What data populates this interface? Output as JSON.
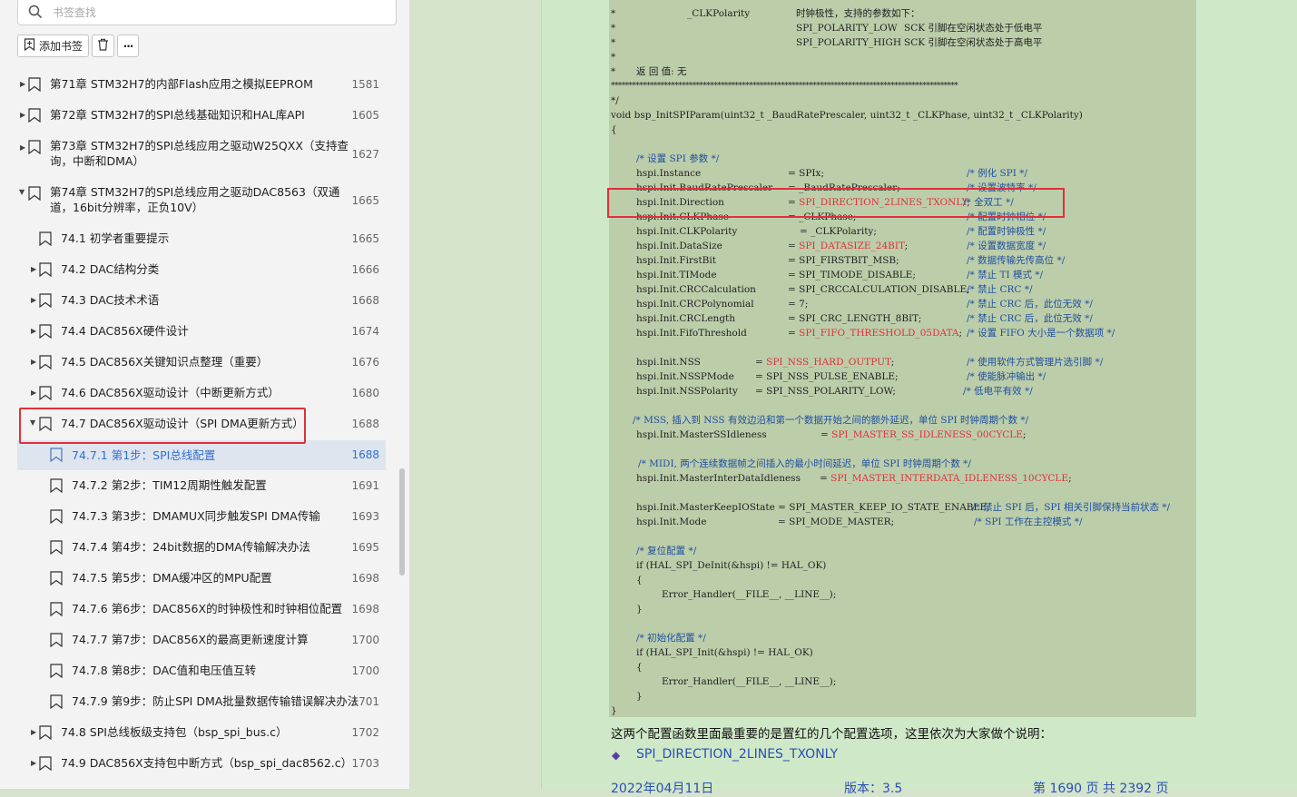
{
  "sidebar": {
    "search": {
      "placeholder": "书签查找"
    },
    "toolbar": {
      "add_label": "添加书签",
      "more_label": "···"
    },
    "items": [
      {
        "label": "第71章 STM32H7的内部Flash应用之模拟EEPROM",
        "page": "1581"
      },
      {
        "label": "第72章 STM32H7的SPI总线基础知识和HAL库API",
        "page": "1605"
      },
      {
        "label": "第73章 STM32H7的SPI总线应用之驱动W25QXX（支持查询，中断和DMA）",
        "page": "1627"
      },
      {
        "label": "第74章 STM32H7的SPI总线应用之驱动DAC8563（双通道，16bit分辨率，正负10V）",
        "page": "1665"
      },
      {
        "label": "74.1 初学者重要提示",
        "page": "1665"
      },
      {
        "label": "74.2 DAC结构分类",
        "page": "1666"
      },
      {
        "label": "74.3 DAC技术术语",
        "page": "1668"
      },
      {
        "label": "74.4 DAC856X硬件设计",
        "page": "1674"
      },
      {
        "label": "74.5 DAC856X关键知识点整理（重要）",
        "page": "1676"
      },
      {
        "label": "74.6 DAC856X驱动设计（中断更新方式）",
        "page": "1680"
      },
      {
        "label": "74.7 DAC856X驱动设计（SPI DMA更新方式）",
        "page": "1688"
      },
      {
        "label": "74.7.1 第1步：SPI总线配置",
        "page": "1688"
      },
      {
        "label": "74.7.2 第2步：TIM12周期性触发配置",
        "page": "1691"
      },
      {
        "label": "74.7.3 第3步：DMAMUX同步触发SPI DMA传输",
        "page": "1693"
      },
      {
        "label": "74.7.4 第4步：24bit数据的DMA传输解决办法",
        "page": "1695"
      },
      {
        "label": "74.7.5 第5步：DMA缓冲区的MPU配置",
        "page": "1698"
      },
      {
        "label": "74.7.6 第6步：DAC856X的时钟极性和时钟相位配置",
        "page": "1698"
      },
      {
        "label": "74.7.7 第7步：DAC856X的最高更新速度计算",
        "page": "1700"
      },
      {
        "label": "74.7.8 第8步：DAC值和电压值互转",
        "page": "1700"
      },
      {
        "label": "74.7.9 第9步：防止SPI DMA批量数据传输错误解决办法",
        "page": "1701"
      },
      {
        "label": "74.8 SPI总线板级支持包（bsp_spi_bus.c）",
        "page": "1702"
      },
      {
        "label": "74.9 DAC856X支持包中断方式（bsp_spi_dac8562.c）",
        "page": "1703"
      }
    ]
  },
  "document": {
    "code": {
      "polarity_name": "_CLKPolarity",
      "polarity_desc": "时钟极性，支持的参数如下：",
      "polarity_low": "SPI_POLARITY_LOW",
      "polarity_low_desc": "SCK 引脚在空闲状态处于低电平",
      "polarity_high": "SPI_POLARITY_HIGH",
      "polarity_high_desc": "SCK 引脚在空闲状态处于高电平",
      "return_note": "返 回 值: 无",
      "star_rule": "**************************************************************************************************",
      "comment_end": "*/",
      "func_sig": "void bsp_InitSPIParam(uint32_t _BaudRatePrescaler, uint32_t _CLKPhase, uint32_t _CLKPolarity)",
      "open_brace": "{",
      "close_brace": "}",
      "cmt_setup": "/* 设置 SPI 参数 */",
      "instance": "hspi.Instance",
      "instance_val": "= SPIx;",
      "instance_cmt": "/* 例化 SPI */",
      "baud": "hspi.Init.BaudRatePrescaler",
      "baud_val": "= _BaudRatePrescaler;",
      "baud_cmt": "/* 设置波特率 */",
      "direction": "hspi.Init.Direction",
      "direction_eq": "= ",
      "direction_val": "SPI_DIRECTION_2LINES_TXONLY",
      "direction_end": ";",
      "direction_cmt": "/* 全双工 */",
      "phase": "hspi.Init.CLKPhase",
      "phase_val": "= _CLKPhase;",
      "phase_cmt": "/* 配置时钟相位 */",
      "polarity": "hspi.Init.CLKPolarity",
      "polarity_val": "= _CLKPolarity;",
      "polarity_cmt": "/* 配置时钟极性 */",
      "datasize": "hspi.Init.DataSize",
      "datasize_eq": "= ",
      "datasize_val": "SPI_DATASIZE_24BIT",
      "datasize_end": ";",
      "datasize_cmt": "/* 设置数据宽度 */",
      "firstbit": "hspi.Init.FirstBit",
      "firstbit_val": "= SPI_FIRSTBIT_MSB;",
      "firstbit_cmt": "/* 数据传输先传高位 */",
      "timode": "hspi.Init.TIMode",
      "timode_val": "= SPI_TIMODE_DISABLE;",
      "timode_cmt": "/* 禁止 TI 模式 */",
      "crccalc": "hspi.Init.CRCCalculation",
      "crccalc_val": "= SPI_CRCCALCULATION_DISABLE;",
      "crccalc_cmt": "/* 禁止 CRC */",
      "crcpoly": "hspi.Init.CRCPolynomial",
      "crcpoly_val": "= 7;",
      "crcpoly_cmt": "/* 禁止 CRC 后，此位无效 */",
      "crclen": "hspi.Init.CRCLength",
      "crclen_val": "= SPI_CRC_LENGTH_8BIT;",
      "crclen_cmt": "/* 禁止 CRC 后，此位无效 */",
      "fifo": "hspi.Init.FifoThreshold",
      "fifo_eq": "= ",
      "fifo_val": "SPI_FIFO_THRESHOLD_05DATA",
      "fifo_end": ";",
      "fifo_cmt": "/* 设置 FIFO 大小是一个数据项 */",
      "nss": "hspi.Init.NSS",
      "nss_eq": "= ",
      "nss_val": "SPI_NSS_HARD_OUTPUT",
      "nss_end": ";",
      "nss_cmt": "/* 使用软件方式管理片选引脚 */",
      "nsspmode": "hspi.Init.NSSPMode",
      "nsspmode_val": "= SPI_NSS_PULSE_ENABLE;",
      "nsspmode_cmt": "/* 使能脉冲输出 */",
      "nsspol": "hspi.Init.NSSPolarity",
      "nsspol_val": "= SPI_NSS_POLARITY_LOW;",
      "nsspol_cmt": "/* 低电平有效 */",
      "mss_cmt": "/* MSS, 插入到 NSS 有效边沿和第一个数据开始之间的额外延迟，单位 SPI 时钟周期个数 */",
      "mss": "hspi.Init.MasterSSIdleness",
      "mss_eq": "= ",
      "mss_val": "SPI_MASTER_SS_IDLENESS_00CYCLE",
      "mss_end": ";",
      "midi_cmt": "/* MIDI, 两个连续数据帧之间插入的最小时间延迟，单位 SPI 时钟周期个数 */",
      "midi": "hspi.Init.MasterInterDataIdleness",
      "midi_eq": "= ",
      "midi_val": "SPI_MASTER_INTERDATA_IDLENESS_10CYCLE",
      "midi_end": ";",
      "keep": "hspi.Init.MasterKeepIOState = SPI_MASTER_KEEP_IO_STATE_ENABLE;",
      "keep_cmt": "/* 禁止 SPI 后，SPI 相关引脚保持当前状态 */",
      "mode": "hspi.Init.Mode",
      "mode_val": "= SPI_MODE_MASTER;",
      "mode_cmt": "/* SPI 工作在主控模式 */",
      "reset_cmt": "/* 复位配置 */",
      "deinit_if": "if (HAL_SPI_DeInit(&hspi) != HAL_OK)",
      "error_call": "Error_Handler(__FILE__, __LINE__);",
      "init_cmt": "/* 初始化配置 */",
      "init_if": "if (HAL_SPI_Init(&hspi) != HAL_OK)"
    },
    "description": "这两个配置函数里面最重要的是置红的几个配置选项，这里依次为大家做个说明：",
    "bullet_item": "SPI_DIRECTION_2LINES_TXONLY",
    "footer": {
      "date": "2022年04月11日",
      "version": "版本：3.5",
      "page_info": "第 1690 页 共 2392 页"
    }
  }
}
